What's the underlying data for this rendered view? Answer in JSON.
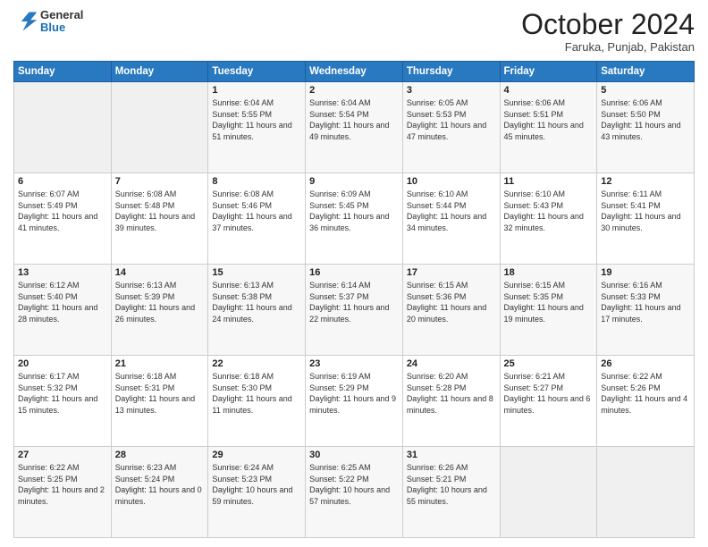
{
  "header": {
    "logo_line1": "General",
    "logo_line2": "Blue",
    "month": "October 2024",
    "location": "Faruka, Punjab, Pakistan"
  },
  "weekdays": [
    "Sunday",
    "Monday",
    "Tuesday",
    "Wednesday",
    "Thursday",
    "Friday",
    "Saturday"
  ],
  "weeks": [
    [
      {
        "day": "",
        "sunrise": "",
        "sunset": "",
        "daylight": ""
      },
      {
        "day": "",
        "sunrise": "",
        "sunset": "",
        "daylight": ""
      },
      {
        "day": "1",
        "sunrise": "Sunrise: 6:04 AM",
        "sunset": "Sunset: 5:55 PM",
        "daylight": "Daylight: 11 hours and 51 minutes."
      },
      {
        "day": "2",
        "sunrise": "Sunrise: 6:04 AM",
        "sunset": "Sunset: 5:54 PM",
        "daylight": "Daylight: 11 hours and 49 minutes."
      },
      {
        "day": "3",
        "sunrise": "Sunrise: 6:05 AM",
        "sunset": "Sunset: 5:53 PM",
        "daylight": "Daylight: 11 hours and 47 minutes."
      },
      {
        "day": "4",
        "sunrise": "Sunrise: 6:06 AM",
        "sunset": "Sunset: 5:51 PM",
        "daylight": "Daylight: 11 hours and 45 minutes."
      },
      {
        "day": "5",
        "sunrise": "Sunrise: 6:06 AM",
        "sunset": "Sunset: 5:50 PM",
        "daylight": "Daylight: 11 hours and 43 minutes."
      }
    ],
    [
      {
        "day": "6",
        "sunrise": "Sunrise: 6:07 AM",
        "sunset": "Sunset: 5:49 PM",
        "daylight": "Daylight: 11 hours and 41 minutes."
      },
      {
        "day": "7",
        "sunrise": "Sunrise: 6:08 AM",
        "sunset": "Sunset: 5:48 PM",
        "daylight": "Daylight: 11 hours and 39 minutes."
      },
      {
        "day": "8",
        "sunrise": "Sunrise: 6:08 AM",
        "sunset": "Sunset: 5:46 PM",
        "daylight": "Daylight: 11 hours and 37 minutes."
      },
      {
        "day": "9",
        "sunrise": "Sunrise: 6:09 AM",
        "sunset": "Sunset: 5:45 PM",
        "daylight": "Daylight: 11 hours and 36 minutes."
      },
      {
        "day": "10",
        "sunrise": "Sunrise: 6:10 AM",
        "sunset": "Sunset: 5:44 PM",
        "daylight": "Daylight: 11 hours and 34 minutes."
      },
      {
        "day": "11",
        "sunrise": "Sunrise: 6:10 AM",
        "sunset": "Sunset: 5:43 PM",
        "daylight": "Daylight: 11 hours and 32 minutes."
      },
      {
        "day": "12",
        "sunrise": "Sunrise: 6:11 AM",
        "sunset": "Sunset: 5:41 PM",
        "daylight": "Daylight: 11 hours and 30 minutes."
      }
    ],
    [
      {
        "day": "13",
        "sunrise": "Sunrise: 6:12 AM",
        "sunset": "Sunset: 5:40 PM",
        "daylight": "Daylight: 11 hours and 28 minutes."
      },
      {
        "day": "14",
        "sunrise": "Sunrise: 6:13 AM",
        "sunset": "Sunset: 5:39 PM",
        "daylight": "Daylight: 11 hours and 26 minutes."
      },
      {
        "day": "15",
        "sunrise": "Sunrise: 6:13 AM",
        "sunset": "Sunset: 5:38 PM",
        "daylight": "Daylight: 11 hours and 24 minutes."
      },
      {
        "day": "16",
        "sunrise": "Sunrise: 6:14 AM",
        "sunset": "Sunset: 5:37 PM",
        "daylight": "Daylight: 11 hours and 22 minutes."
      },
      {
        "day": "17",
        "sunrise": "Sunrise: 6:15 AM",
        "sunset": "Sunset: 5:36 PM",
        "daylight": "Daylight: 11 hours and 20 minutes."
      },
      {
        "day": "18",
        "sunrise": "Sunrise: 6:15 AM",
        "sunset": "Sunset: 5:35 PM",
        "daylight": "Daylight: 11 hours and 19 minutes."
      },
      {
        "day": "19",
        "sunrise": "Sunrise: 6:16 AM",
        "sunset": "Sunset: 5:33 PM",
        "daylight": "Daylight: 11 hours and 17 minutes."
      }
    ],
    [
      {
        "day": "20",
        "sunrise": "Sunrise: 6:17 AM",
        "sunset": "Sunset: 5:32 PM",
        "daylight": "Daylight: 11 hours and 15 minutes."
      },
      {
        "day": "21",
        "sunrise": "Sunrise: 6:18 AM",
        "sunset": "Sunset: 5:31 PM",
        "daylight": "Daylight: 11 hours and 13 minutes."
      },
      {
        "day": "22",
        "sunrise": "Sunrise: 6:18 AM",
        "sunset": "Sunset: 5:30 PM",
        "daylight": "Daylight: 11 hours and 11 minutes."
      },
      {
        "day": "23",
        "sunrise": "Sunrise: 6:19 AM",
        "sunset": "Sunset: 5:29 PM",
        "daylight": "Daylight: 11 hours and 9 minutes."
      },
      {
        "day": "24",
        "sunrise": "Sunrise: 6:20 AM",
        "sunset": "Sunset: 5:28 PM",
        "daylight": "Daylight: 11 hours and 8 minutes."
      },
      {
        "day": "25",
        "sunrise": "Sunrise: 6:21 AM",
        "sunset": "Sunset: 5:27 PM",
        "daylight": "Daylight: 11 hours and 6 minutes."
      },
      {
        "day": "26",
        "sunrise": "Sunrise: 6:22 AM",
        "sunset": "Sunset: 5:26 PM",
        "daylight": "Daylight: 11 hours and 4 minutes."
      }
    ],
    [
      {
        "day": "27",
        "sunrise": "Sunrise: 6:22 AM",
        "sunset": "Sunset: 5:25 PM",
        "daylight": "Daylight: 11 hours and 2 minutes."
      },
      {
        "day": "28",
        "sunrise": "Sunrise: 6:23 AM",
        "sunset": "Sunset: 5:24 PM",
        "daylight": "Daylight: 11 hours and 0 minutes."
      },
      {
        "day": "29",
        "sunrise": "Sunrise: 6:24 AM",
        "sunset": "Sunset: 5:23 PM",
        "daylight": "Daylight: 10 hours and 59 minutes."
      },
      {
        "day": "30",
        "sunrise": "Sunrise: 6:25 AM",
        "sunset": "Sunset: 5:22 PM",
        "daylight": "Daylight: 10 hours and 57 minutes."
      },
      {
        "day": "31",
        "sunrise": "Sunrise: 6:26 AM",
        "sunset": "Sunset: 5:21 PM",
        "daylight": "Daylight: 10 hours and 55 minutes."
      },
      {
        "day": "",
        "sunrise": "",
        "sunset": "",
        "daylight": ""
      },
      {
        "day": "",
        "sunrise": "",
        "sunset": "",
        "daylight": ""
      }
    ]
  ]
}
